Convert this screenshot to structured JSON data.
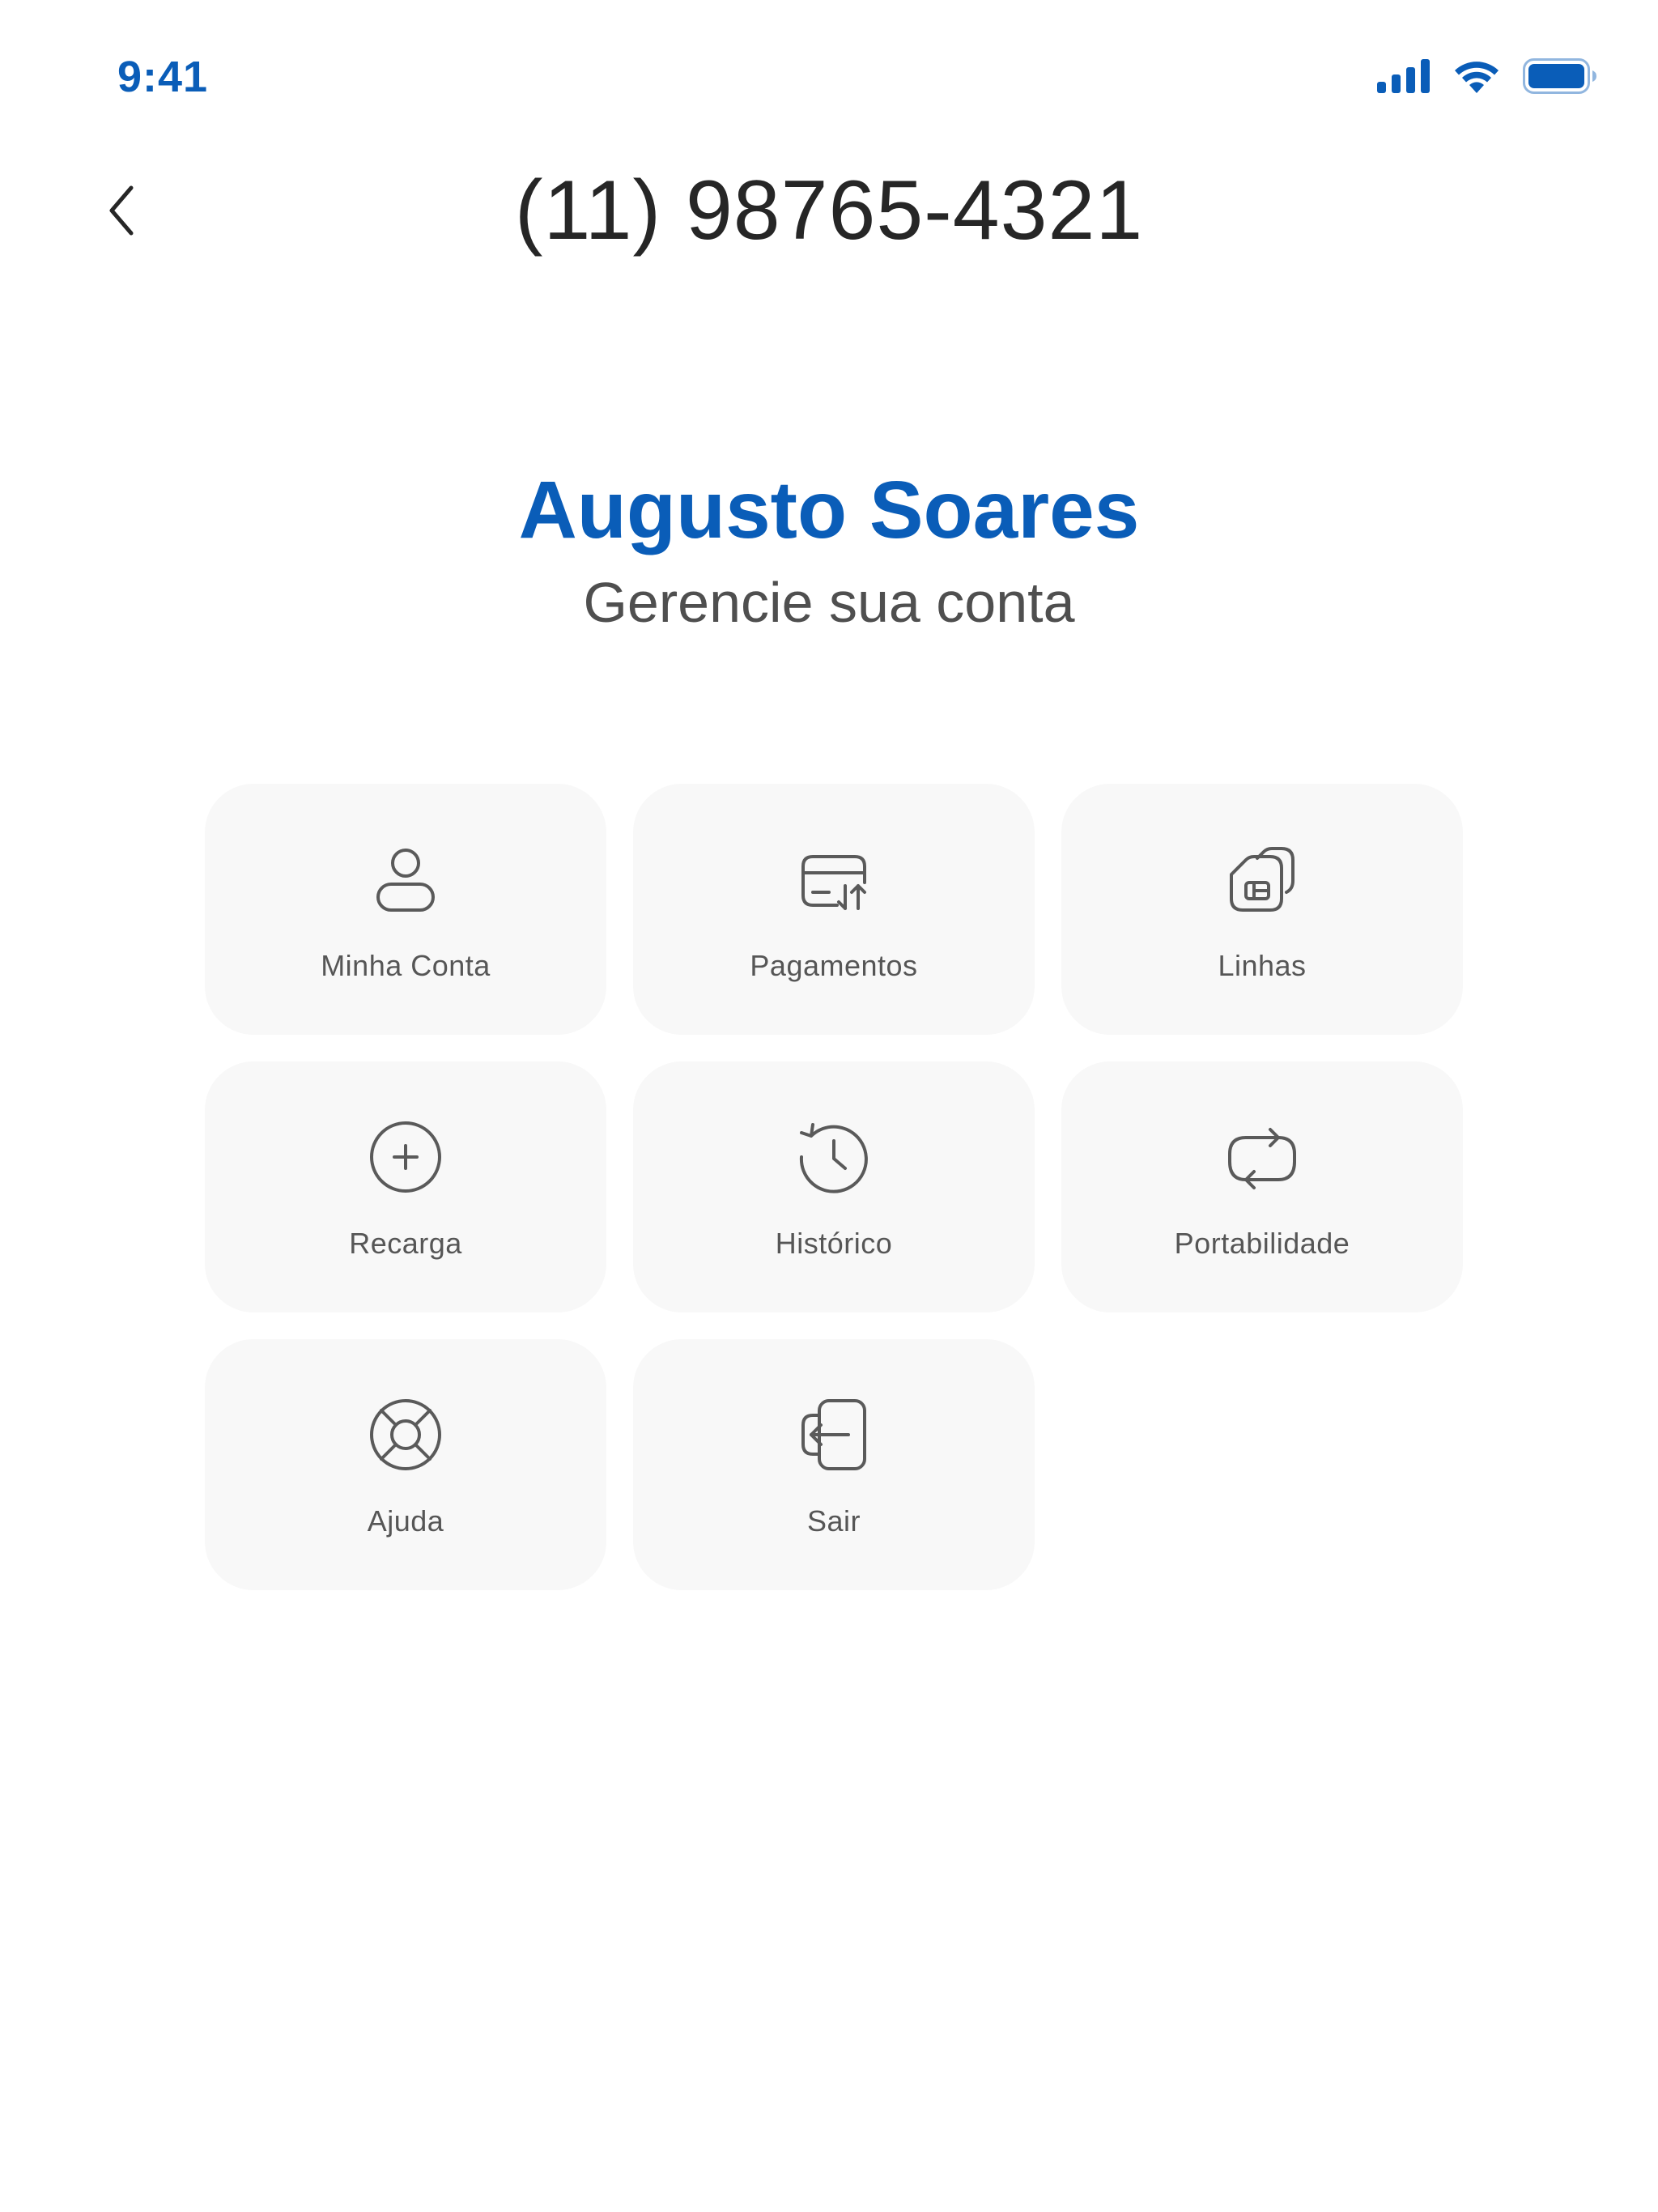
{
  "status_bar": {
    "time": "9:41",
    "icons": [
      "cellular-signal-icon",
      "wifi-icon",
      "battery-icon"
    ],
    "accent_color": "#0a5db8"
  },
  "header": {
    "title": "(11) 98765-4321",
    "back_icon": "chevron-left-icon"
  },
  "profile": {
    "name": "Augusto Soares",
    "subtitle": "Gerencie sua conta"
  },
  "menu": {
    "items": [
      {
        "label": "Minha Conta",
        "icon": "user-icon"
      },
      {
        "label": "Pagamentos",
        "icon": "card-transfer-icon"
      },
      {
        "label": "Linhas",
        "icon": "sim-cards-icon"
      },
      {
        "label": "Recarga",
        "icon": "plus-circle-icon"
      },
      {
        "label": "Histórico",
        "icon": "history-icon"
      },
      {
        "label": "Portabilidade",
        "icon": "repeat-icon"
      },
      {
        "label": "Ajuda",
        "icon": "lifebuoy-icon"
      },
      {
        "label": "Sair",
        "icon": "logout-icon"
      }
    ]
  },
  "colors": {
    "accent": "#0a5db8",
    "tile_background": "#f8f8f8",
    "icon_stroke": "#5a5a5a",
    "title_text": "#262626"
  }
}
